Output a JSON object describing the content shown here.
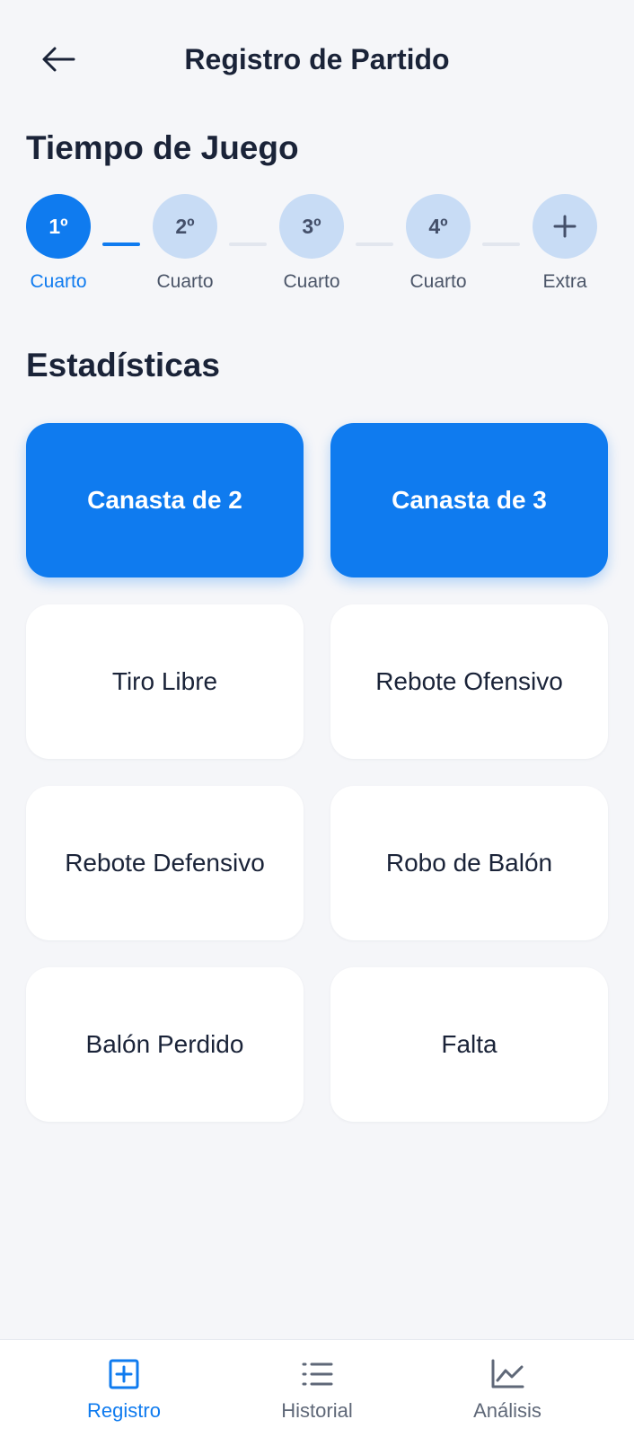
{
  "header": {
    "title": "Registro de Partido",
    "back_icon": "arrow-left-icon"
  },
  "game_time": {
    "title": "Tiempo de Juego",
    "quarters": [
      {
        "badge": "1º",
        "label": "Cuarto",
        "active": true
      },
      {
        "badge": "2º",
        "label": "Cuarto",
        "active": false
      },
      {
        "badge": "3º",
        "label": "Cuarto",
        "active": false
      },
      {
        "badge": "4º",
        "label": "Cuarto",
        "active": false
      },
      {
        "badge": "+",
        "label": "Extra",
        "active": false
      }
    ]
  },
  "stats": {
    "title": "Estadísticas",
    "buttons": [
      {
        "label": "Canasta de 2",
        "primary": true
      },
      {
        "label": "Canasta de 3",
        "primary": true
      },
      {
        "label": "Tiro Libre",
        "primary": false
      },
      {
        "label": "Rebote Ofensivo",
        "primary": false
      },
      {
        "label": "Rebote Defensivo",
        "primary": false
      },
      {
        "label": "Robo de Balón",
        "primary": false
      },
      {
        "label": "Balón Perdido",
        "primary": false
      },
      {
        "label": "Falta",
        "primary": false
      }
    ]
  },
  "tabbar": {
    "tabs": [
      {
        "label": "Registro",
        "icon": "plus-square-icon",
        "active": true
      },
      {
        "label": "Historial",
        "icon": "list-icon",
        "active": false
      },
      {
        "label": "Análisis",
        "icon": "line-chart-icon",
        "active": false
      }
    ]
  },
  "colors": {
    "accent": "#0F7BEF",
    "inactive_circle": "#C8DCF5",
    "background": "#F5F6F9"
  }
}
